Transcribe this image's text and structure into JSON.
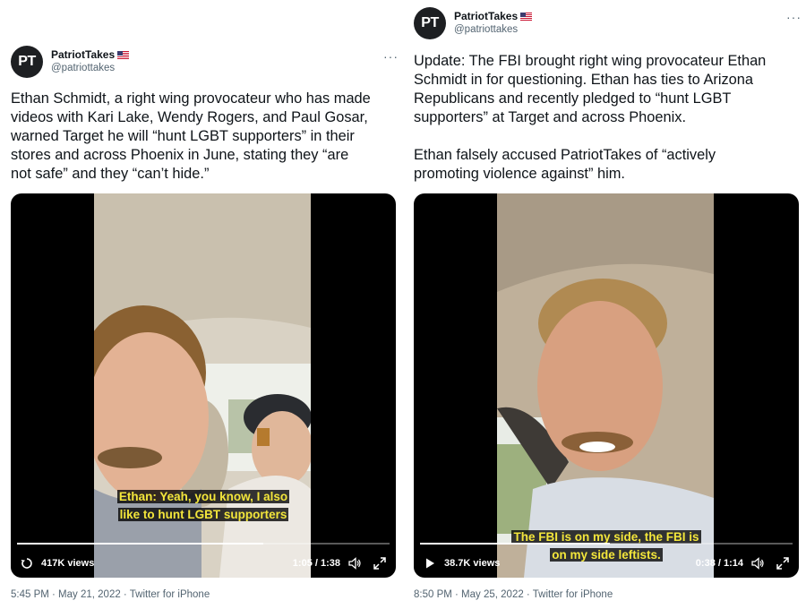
{
  "tweets": [
    {
      "author": {
        "name": "PatriotTakes",
        "handle": "@patriottakes",
        "avatar_initials": "PT"
      },
      "text": "Ethan Schmidt, a right wing provocateur who has made\nvideos with Kari Lake, Wendy Rogers, and Paul Gosar,\nwarned Target he will “hunt LGBT supporters” in their\nstores and across Phoenix in June, stating they “are\nnot safe” and they “can’t hide.”",
      "video": {
        "caption_line1": "Ethan: Yeah, you know, I also",
        "caption_line2": "like to hunt LGBT supporters",
        "views": "417K views",
        "time": "1:05 / 1:38",
        "progress": 0.66
      },
      "footer": "5:45 PM · May 21, 2022 · Twitter for iPhone"
    },
    {
      "author": {
        "name": "PatriotTakes",
        "handle": "@patriottakes",
        "avatar_initials": "PT"
      },
      "text": "Update: The FBI brought right wing provocateur Ethan\nSchmidt in for questioning. Ethan has ties to Arizona\nRepublicans and recently pledged to “hunt LGBT\nsupporters” at Target and across Phoenix.\n\nEthan falsely accused PatriotTakes of “actively\npromoting violence against” him.",
      "video": {
        "caption_line1": "The FBI is on my side, the FBI is",
        "caption_line2": "on my side leftists.",
        "views": "38.7K views",
        "time": "0:38 / 1:14",
        "progress": 0.51
      },
      "footer": "8:50 PM · May 25, 2022 · Twitter for iPhone"
    }
  ],
  "colors": {
    "caption": "#f3e63b",
    "secondary_text": "#536471",
    "avatar_bg": "#1d1f22"
  }
}
